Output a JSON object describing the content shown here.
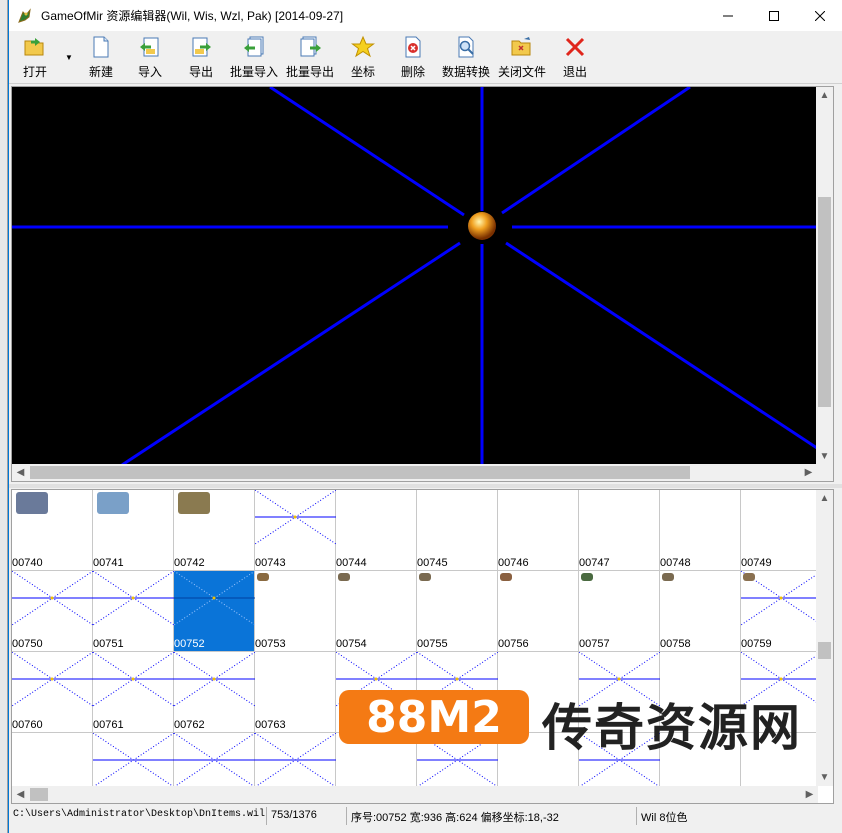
{
  "window": {
    "title": "GameOfMir 资源编辑器(Wil, Wis, Wzl, Pak) [2014-09-27]",
    "app_icon": "dragon-icon"
  },
  "toolbar": [
    {
      "label": "打开",
      "icon": "open-folder-icon"
    },
    {
      "label": "新建",
      "icon": "new-file-icon"
    },
    {
      "label": "导入",
      "icon": "import-icon"
    },
    {
      "label": "导出",
      "icon": "export-icon"
    },
    {
      "label": "批量导入",
      "icon": "batch-import-icon"
    },
    {
      "label": "批量导出",
      "icon": "batch-export-icon"
    },
    {
      "label": "坐标",
      "icon": "star-icon"
    },
    {
      "label": "删除",
      "icon": "delete-icon"
    },
    {
      "label": "数据转换",
      "icon": "convert-icon"
    },
    {
      "label": "关闭文件",
      "icon": "close-file-icon"
    },
    {
      "label": "退出",
      "icon": "exit-icon"
    }
  ],
  "grid": {
    "rows": [
      [
        "00740",
        "00741",
        "00742",
        "00743",
        "00744",
        "00745",
        "00746",
        "00747",
        "00748",
        "00749"
      ],
      [
        "00750",
        "00751",
        "00752",
        "00753",
        "00754",
        "00755",
        "00756",
        "00757",
        "00758",
        "00759"
      ],
      [
        "00760",
        "00761",
        "00762",
        "00763",
        "",
        "",
        "",
        "",
        "",
        ""
      ]
    ],
    "selected": "00752"
  },
  "status": {
    "path": "C:\\Users\\Administrator\\Desktop\\DnItems.wil",
    "count": "753/1376",
    "info": "序号:00752 宽:936 高:624 偏移坐标:18,-32",
    "format": "Wil 8位色"
  },
  "watermark": {
    "badge": "88M2",
    "text": "传奇资源网"
  },
  "colors": {
    "selection": "#0a74d8",
    "cross_line": "#0000ff",
    "watermark_orange": "#f47a14"
  }
}
